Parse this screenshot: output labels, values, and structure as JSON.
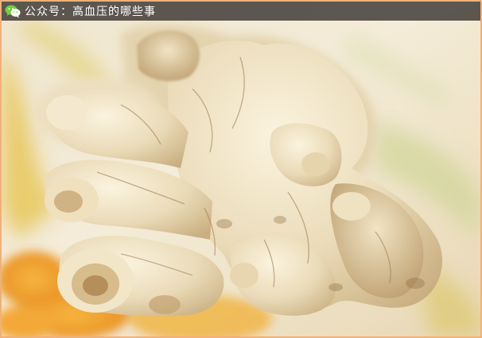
{
  "watermark": {
    "icon": "wechat-icon",
    "text": "公众号：高血压的哪些事"
  },
  "photo": {
    "subject": "ginger-root",
    "colors": {
      "border": "#f0b07a",
      "background": "#f6e9d2",
      "ginger_light": "#f3e6c8",
      "ginger_shadow": "#b89a6a",
      "orange_accent": "#f0a030",
      "yellow_accent": "#e8c640"
    }
  }
}
